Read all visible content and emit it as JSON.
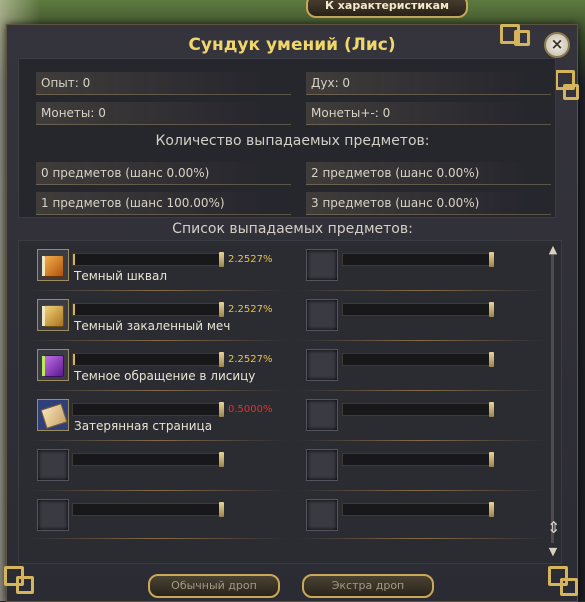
{
  "top_tab": {
    "label": "К характеристикам"
  },
  "window": {
    "title": "Сундук умений (Лис)",
    "close_label": "×"
  },
  "stats": {
    "exp": "Опыт: 0",
    "spirit": "Дух: 0",
    "coins": "Монеты: 0",
    "coins_pm": "Монеты+-: 0"
  },
  "drop_count": {
    "header": "Количество выпадаемых предметов:",
    "items": [
      "0 предметов (шанс 0.00%)",
      "2 предметов (шанс 0.00%)",
      "1 предметов (шанс 100.00%)",
      "3 предметов (шанс 0.00%)"
    ]
  },
  "drop_list": {
    "header": "Список выпадаемых предметов:",
    "items": [
      {
        "name": "Темный шквал",
        "percent": "2.2527%",
        "icon": "orange-book-icon",
        "fill": 0.015
      },
      {
        "name": "Темный закаленный меч",
        "percent": "2.2527%",
        "icon": "gold-book-icon",
        "fill": 0.015
      },
      {
        "name": "Темное обращение в лисицу",
        "percent": "2.2527%",
        "icon": "purple-book-icon",
        "fill": 0.015
      },
      {
        "name": "Затерянная страница",
        "percent": "0.5000%",
        "icon": "scroll-page-icon",
        "fill": 0
      }
    ]
  },
  "scroll": {
    "up": "▲",
    "thumb": "⇕",
    "down": "▼"
  },
  "buttons": {
    "normal_drop": "Обычный дроп",
    "extra_drop": "Экстра дроп"
  },
  "colors": {
    "title": "#f1d66c",
    "percent": "#e6c14a",
    "percent_low": "#e0322b",
    "border_gold": "#c9a85a"
  }
}
